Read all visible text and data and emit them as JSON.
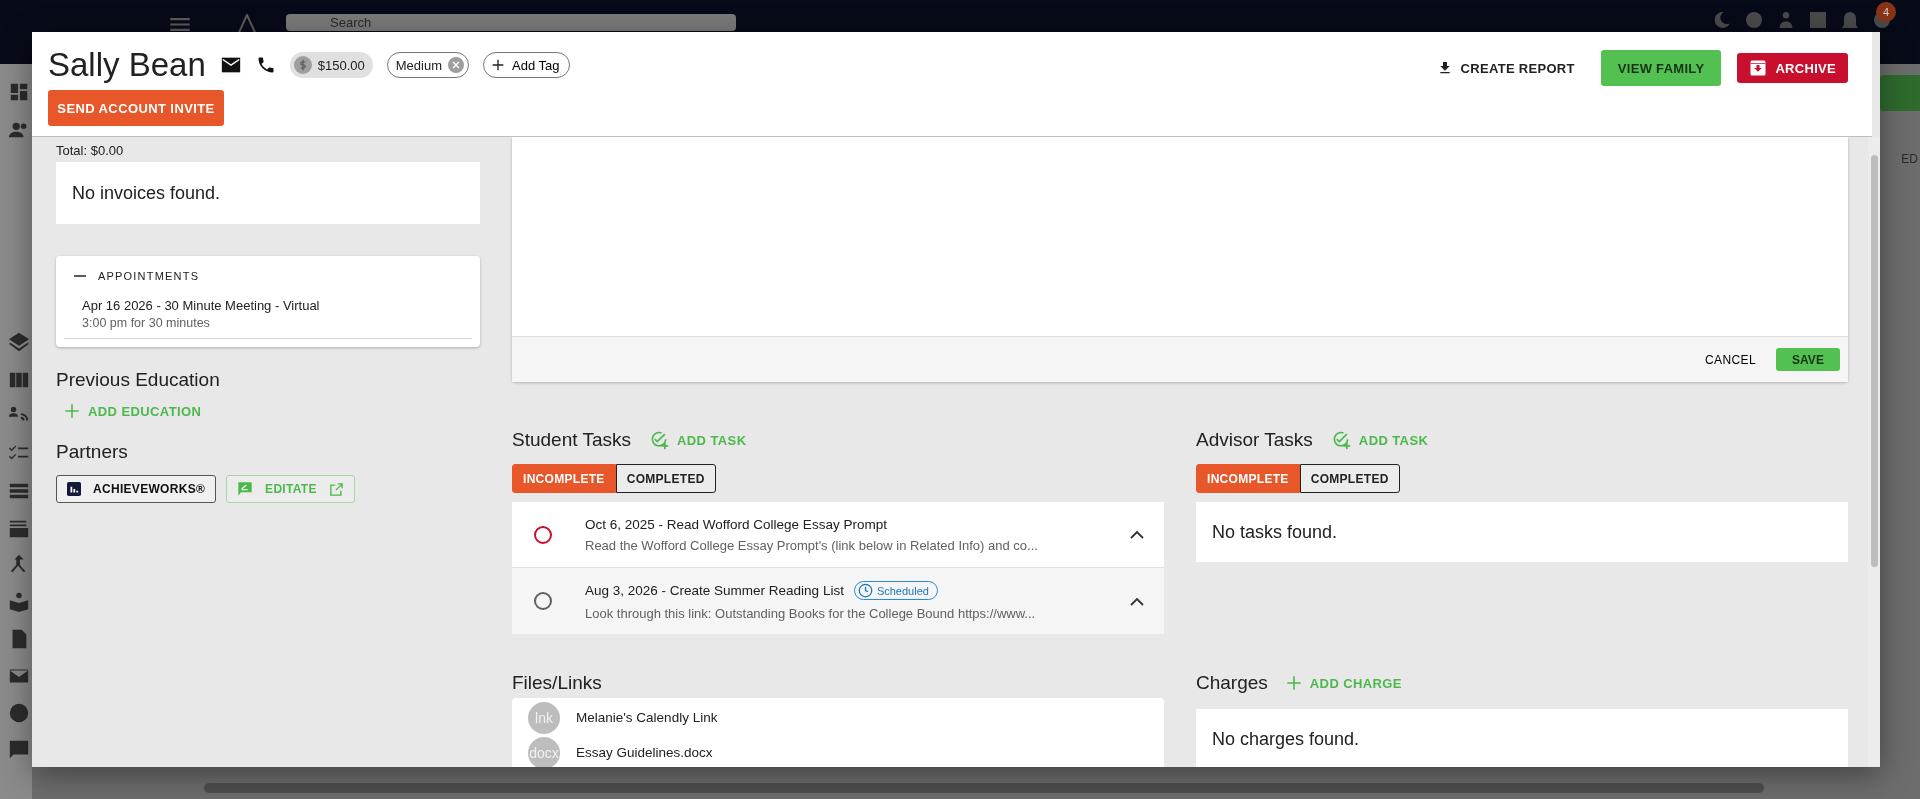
{
  "background": {
    "search_placeholder": "Search",
    "notification_count": "4",
    "edge_label": "ED"
  },
  "header": {
    "name": "Sally Bean",
    "balance": "$150.00",
    "tags": [
      {
        "label": "Medium",
        "removable": true
      }
    ],
    "add_tag": "Add Tag",
    "invite_button": "SEND ACCOUNT INVITE",
    "actions": [
      {
        "label": "CREATE REPORT",
        "kind": "text"
      },
      {
        "label": "VIEW FAMILY",
        "kind": "green"
      },
      {
        "label": "ARCHIVE",
        "kind": "red"
      }
    ]
  },
  "left": {
    "invoices": {
      "total": "Total: $0.00",
      "empty": "No invoices found."
    },
    "appointments": {
      "title": "APPOINTMENTS",
      "items": [
        {
          "title": "Apr 16 2026 - 30 Minute Meeting - Virtual",
          "subtitle": "3:00 pm for 30 minutes"
        }
      ]
    },
    "previous_education": {
      "title": "Previous Education",
      "add": "ADD EDUCATION"
    },
    "partners": {
      "title": "Partners",
      "items": [
        {
          "label": "ACHIEVEWORKS®",
          "kind": "dark"
        },
        {
          "label": "EDITATE",
          "kind": "green"
        }
      ]
    }
  },
  "editor": {
    "cancel": "CANCEL",
    "save": "SAVE"
  },
  "student_tasks": {
    "title": "Student Tasks",
    "add": "ADD TASK",
    "tabs": [
      {
        "label": "INCOMPLETE",
        "selected": true
      },
      {
        "label": "COMPLETED",
        "selected": false
      }
    ],
    "items": [
      {
        "title": "Oct 6, 2025 - Read Wofford College Essay Prompt",
        "description": "Read the Wofford College Essay Prompt's (link below in Related Info) and co...",
        "color": "#c8102e",
        "expanded": true,
        "highlighted": false
      },
      {
        "title": "Aug 3, 2026 - Create Summer Reading List",
        "status": "Scheduled",
        "description": "Look through this link: Outstanding Books for the College Bound https://www...",
        "color": "#616161",
        "expanded": true,
        "highlighted": true
      }
    ]
  },
  "advisor_tasks": {
    "title": "Advisor Tasks",
    "add": "ADD TASK",
    "tabs": [
      {
        "label": "INCOMPLETE",
        "selected": true
      },
      {
        "label": "COMPLETED",
        "selected": false
      }
    ],
    "empty": "No tasks found."
  },
  "files": {
    "title": "Files/Links",
    "items": [
      {
        "avatar": "lnk",
        "name": "Melanie's Calendly Link"
      },
      {
        "avatar": "docx",
        "name": "Essay Guidelines.docx"
      }
    ]
  },
  "charges": {
    "title": "Charges",
    "add": "ADD CHARGE",
    "empty": "No charges found."
  }
}
